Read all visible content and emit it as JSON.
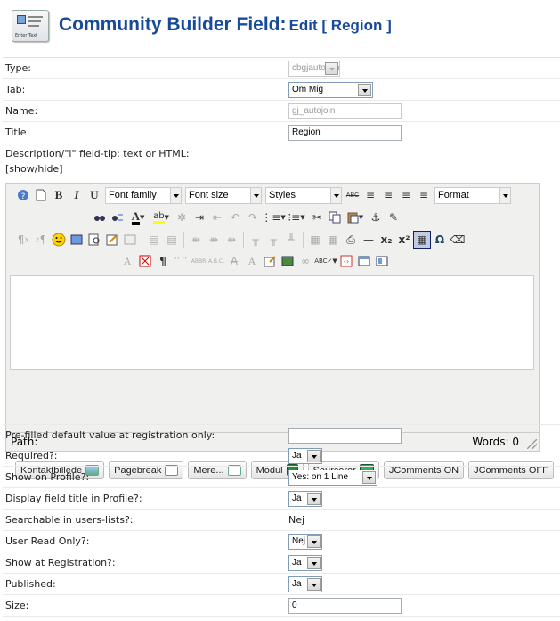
{
  "header": {
    "icon_caption": "Enter Text",
    "title": "Community Builder Field:",
    "subtitle": "Edit [ Region ]"
  },
  "form": {
    "type": {
      "label": "Type:",
      "value": "cbgjautojoin"
    },
    "tab": {
      "label": "Tab:",
      "value": "Om Mig"
    },
    "name": {
      "label": "Name:",
      "value": "gj_autojoin"
    },
    "title": {
      "label": "Title:",
      "value": "Region"
    },
    "description": {
      "label": "Description/\"i\" field-tip: text or HTML:",
      "toggle": "[show/hide]"
    },
    "prefilled": {
      "label": "Pre-filled default value at registration only:",
      "value": ""
    },
    "required": {
      "label": "Required?:",
      "value": "Ja"
    },
    "show_on_profile": {
      "label": "Show on Profile?:",
      "value": "Yes: on 1 Line"
    },
    "display_title": {
      "label": "Display field title in Profile?:",
      "value": "Ja"
    },
    "searchable": {
      "label": "Searchable in users-lists?:",
      "value": "Nej"
    },
    "user_read_only": {
      "label": "User Read Only?:",
      "value": "Nej"
    },
    "show_at_registration": {
      "label": "Show at Registration?:",
      "value": "Ja"
    },
    "published": {
      "label": "Published:",
      "value": "Ja"
    },
    "size": {
      "label": "Size:",
      "value": "0"
    }
  },
  "editor": {
    "font_family": "Font family",
    "font_size": "Font size",
    "styles": "Styles",
    "format": "Format",
    "path_label": "Path:",
    "words_label": "Words: 0",
    "icons": {
      "row1": [
        "help-icon",
        "new-document-icon",
        "bold-icon",
        "italic-icon",
        "underline-icon",
        "strikethrough-icon",
        "align-left-icon",
        "align-center-icon",
        "align-right-icon",
        "align-justify-icon"
      ],
      "row2": [
        "find-icon",
        "replace-icon",
        "text-color-icon",
        "highlight-icon",
        "cleanup-icon",
        "indent-icon",
        "outdent-icon",
        "undo-icon",
        "redo-icon",
        "numbered-list-icon",
        "bullet-list-icon",
        "cut-icon",
        "copy-icon",
        "paste-icon",
        "anchor-icon",
        "clear-format-icon"
      ],
      "row3": [
        "ltr-icon",
        "rtl-icon",
        "emoticon-icon",
        "media-icon",
        "preview-icon",
        "edit-icon",
        "image-icon",
        "table-icon",
        "table-row-icon",
        "table-col-icon",
        "horizontal-rule-icon",
        "subscript-icon",
        "superscript-icon",
        "visual-aid-icon",
        "special-char-icon",
        "eraser-icon"
      ],
      "row4": [
        "styles-icon",
        "remove-format-icon",
        "paragraph-icon",
        "quote-icon",
        "abbr-icon",
        "acronym-icon",
        "deleted-icon",
        "inserted-icon",
        "attributes-icon",
        "image-insert-icon",
        "link-icon",
        "spellcheck-icon",
        "source-icon",
        "fullscreen-icon",
        "layer-icon"
      ]
    },
    "glyphs": {
      "bold": "B",
      "italic": "I",
      "underline": "U",
      "strike": "ABC",
      "text_color": "A",
      "highlight": "ab",
      "subscript": "x₂",
      "superscript": "x²",
      "omega": "Ω",
      "pilcrow": "¶",
      "quote": "‘‘ ’’",
      "abbr": "ABBR",
      "acronym": "A.B.C.",
      "styles_a": "A",
      "strike_a": "A",
      "insert_a": "A",
      "em_dash": "—"
    }
  },
  "editor_buttons": [
    {
      "label": "Kontaktbillede",
      "icon": "image-icon"
    },
    {
      "label": "Pagebreak",
      "icon": "pagebreak-icon"
    },
    {
      "label": "Mere...",
      "icon": "readmore-icon"
    },
    {
      "label": "Modul",
      "icon": "module-icon"
    },
    {
      "label": "Sourcerer",
      "icon": "sourcerer-icon"
    },
    {
      "label": "JComments ON",
      "icon": ""
    },
    {
      "label": "JComments OFF",
      "icon": ""
    }
  ],
  "colors": {
    "title_blue": "#184a9a",
    "editor_bg": "#f0f0ee",
    "border": "#cccccc"
  }
}
